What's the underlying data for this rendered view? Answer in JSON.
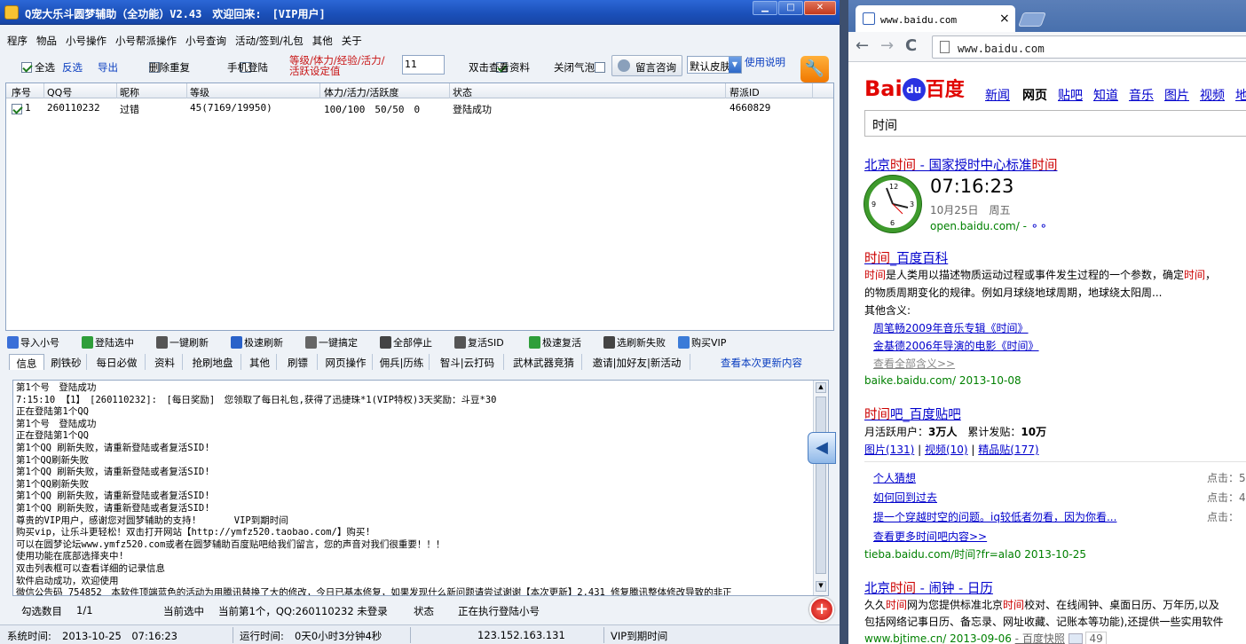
{
  "app": {
    "title": "Q宠大乐斗圆梦辅助（全功能）V2.43　欢迎回来:　[VIP用户]",
    "window_buttons": [
      "▁",
      "□",
      "✕"
    ],
    "menu": [
      "程序",
      "物品",
      "小号操作",
      "小号帮派操作",
      "小号查询",
      "活动/签到/礼包",
      "其他",
      "关于"
    ],
    "options": {
      "select_all": "全选",
      "invert": "反选",
      "export": "导出",
      "dedupe": "删除重复",
      "phone_login": "手机登陆",
      "threshold_label_1": "等级/体力/经验/活力/",
      "threshold_label_2": "活跃设定值",
      "threshold_value": "11",
      "dblclick_view": "双击查看资料",
      "close_bubble": "关闭气泡",
      "feedback": "留言咨询",
      "skin": "默认皮肤",
      "usage": "使用说明"
    },
    "table": {
      "headers": [
        "序号",
        "QQ号",
        "昵称",
        "等级",
        "体力/活力/活跃度",
        "状态",
        "帮派ID"
      ],
      "rows": [
        {
          "idx": "1",
          "qq": "260110232",
          "nick": "过错",
          "level": "45(7169/19950)",
          "stats": "100/100　50/50　0",
          "status": "登陆成功",
          "guild": "4660829"
        }
      ]
    },
    "actions": [
      "导入小号",
      "登陆选中",
      "一键刷新",
      "极速刷新",
      "一键搞定",
      "全部停止",
      "复活SID",
      "极速复活",
      "选刷新失败",
      "购买VIP"
    ],
    "action_icon_colors": [
      "#3a6fd8",
      "#2f9e3a",
      "#555555",
      "#2a62c9",
      "#666666",
      "#444444",
      "#555555",
      "#2f9e3a",
      "#444444",
      "#3b7bd8"
    ],
    "tabs": [
      "信息",
      "刷铁砂",
      "每日必做",
      "资料",
      "抢刷地盘",
      "其他",
      "刷镖",
      "网页操作",
      "佣兵|历练",
      "智斗|云打码",
      "武林武器竞猜",
      "邀请|加好友|新活动"
    ],
    "check_updates": "查看本次更新内容",
    "log": [
      "第1个号　登陆成功",
      "7:15:10 【1】　[260110232]:　[每日奖励]　您领取了每日礼包,获得了迅捷珠*1(VIP特权)3天奖励：斗豆*30",
      "正在登陆第1个QQ",
      "第1个号　登陆成功",
      "正在登陆第1个QQ",
      "第1个QQ 刷新失败，请重新登陆或者复活SID!",
      "第1个QQ刷新失败",
      "第1个QQ 刷新失败，请重新登陆或者复活SID!",
      "第1个QQ刷新失败",
      "第1个QQ 刷新失败，请重新登陆或者复活SID!",
      "第1个QQ 刷新失败，请重新登陆或者复活SID!",
      "尊贵的VIP用户，感谢您对圆梦辅助的支持!　　　　VIP到期时间",
      "购买vip，让乐斗更轻松！双击打开网站【http://ymfz520.taobao.com/】购买!",
      "可以在圆梦论坛www.ymfz520.com或者在圆梦辅助百度贴吧给我们留言，您的声音对我们很重要！！！",
      "使用功能在底部选择夹中!",
      "双击列表框可以查看详细的记录信息",
      "软件启动成功，欢迎使用",
      "微信公告码 754852　本软件顶端蓝色的活动为用腾讯替换了大的修改，今日已基本修复，如果发现什么新问题请尝试谢谢【本次更新】2.431 修复腾讯整体修改导致的非正"
    ],
    "selection": {
      "count_label": "勾选数目",
      "count": "1/1",
      "current_label": "当前选中",
      "current_value": "当前第1个，QQ:260110232 未登录",
      "state_label": "状态",
      "state_value": "正在执行登陆小号"
    },
    "statusbar": {
      "time_label": "系统时间:",
      "time_value": "2013-10-25　07:16:23",
      "run_label": "运行时间:",
      "run_value": "0天0小时3分钟4秒",
      "ip": "123.152.163.131",
      "vip": "VIP到期时间"
    }
  },
  "browser": {
    "tab_title": "www.baidu.com",
    "tab_close": "×",
    "url": "www.baidu.com",
    "nav_buttons": [
      "←",
      "→",
      "C"
    ],
    "logo": {
      "bai": "Bai",
      "du": "du",
      "cn": "百度"
    },
    "nav_links": [
      "新闻",
      "网页",
      "贴吧",
      "知道",
      "音乐",
      "图片",
      "视频",
      "地"
    ],
    "query": "时间",
    "results": {
      "r1": {
        "title_pre": "北京",
        "title_em1": "时间",
        "title_mid": " - 国家授时中心标准",
        "title_em2": "时间",
        "clock_time": "07:16:23",
        "date": "10月25日　周五",
        "url": "open.baidu.com/ -"
      },
      "r2": {
        "title_em": "时间",
        "title_rest": "_百度百科",
        "snippet1_em": "时间",
        "snippet1": "是人类用以描述物质运动过程或事件发生过程的一个参数，确定",
        "snippet1_em2": "时间",
        "snippet1_tail": "，",
        "snippet2": "的物质周期变化的规律。例如月球绕地球周期，地球绕太阳周...",
        "meanings_label": "其他含义:",
        "meaning1": "周笔畅2009年音乐专辑《时间》",
        "meaning2": "金基德2006年导演的电影《时间》",
        "all_meanings": "查看全部含义>>",
        "url": "baike.baidu.com/ 2013-10-08"
      },
      "r3": {
        "title_em": "时间",
        "title_rest": "吧_百度贴吧",
        "stats_label1": "月活跃用户：",
        "stats_val1": "3万人",
        "stats_label2": "　累计发贴：",
        "stats_val2": "10万",
        "links": [
          "图片(131)",
          "视频(10)",
          "精品贴(177)"
        ],
        "posts": [
          "个人猜想",
          "如何回到过去",
          "提一个穿越时空的问题。iq较低者勿看，因为你看..."
        ],
        "click_label": [
          "点击：5",
          "点击：4",
          "点击："
        ],
        "more": "查看更多时间吧内容>>",
        "url": "tieba.baidu.com/时间?fr=ala0 2013-10-25"
      },
      "r4": {
        "title_pre": "北京",
        "title_em": "时间",
        "title_rest": " - 闹钟 - 日历",
        "line1_pre": "久久",
        "line1_em": "时间",
        "line1_mid": "网为您提供标准北京",
        "line1_em2": "时间",
        "line1_tail": "校对、在线闹钟、桌面日历、万年历,以及",
        "line2": "包括网络记事日历、备忘录、网址收藏、记账本等功能),还提供一些实用软件",
        "url": "www.bjtime.cn/ 2013-09-06",
        "snapshot": "- 百度快照",
        "share_count": "49"
      }
    }
  }
}
